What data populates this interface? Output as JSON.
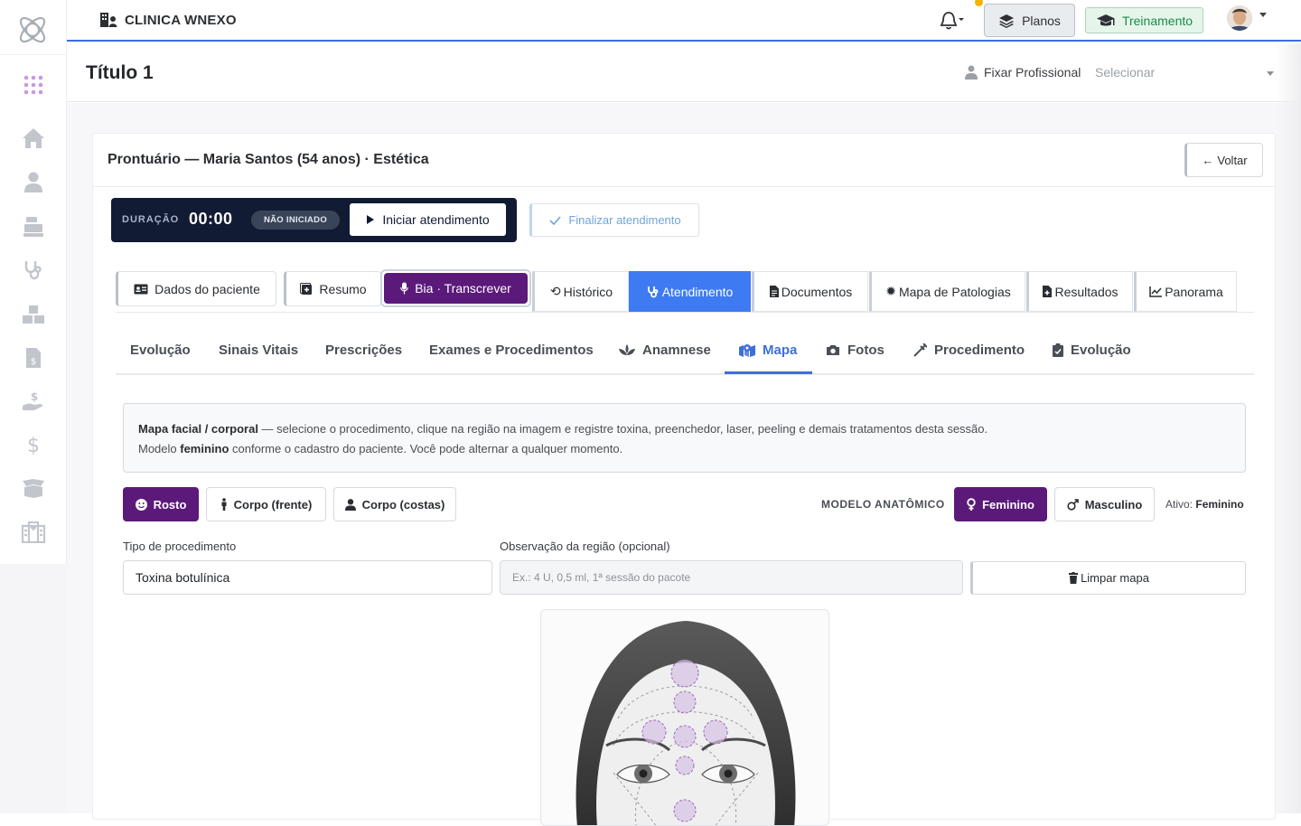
{
  "brand": {
    "name": "CLINICA WNEXO"
  },
  "topbar": {
    "planos": "Planos",
    "treinamento": "Treinamento"
  },
  "page": {
    "title": "Título 1",
    "fixar_label": "Fixar Profissional",
    "select_placeholder": "Selecionar"
  },
  "record": {
    "title": "Prontuário — Maria Santos (54 anos) · Estética",
    "back": "Voltar"
  },
  "timer": {
    "label": "DURAÇÃO",
    "value": "00:00",
    "status": "NÃO INICIADO",
    "start": "Iniciar atendimento",
    "finish": "Finalizar atendimento"
  },
  "tabs": {
    "dados": "Dados do paciente",
    "resumo": "Resumo",
    "bia": "Bia · Transcrever",
    "historico": "Histórico",
    "atendimento": "Atendimento",
    "documentos": "Documentos",
    "mapa_patologias": "Mapa de Patologias",
    "resultados": "Resultados",
    "panorama": "Panorama"
  },
  "subtabs": [
    "Evolução",
    "Sinais Vitais",
    "Prescrições",
    "Exames e Procedimentos",
    "Anamnese",
    "Mapa",
    "Fotos",
    "Procedimento",
    "Evolução"
  ],
  "info": {
    "strong1": "Mapa facial / corporal",
    "text1": " — selecione o procedimento, clique na região na imagem e registre toxina, preenchedor, laser, peeling e demais tratamentos desta sessão.",
    "text2a": "Modelo ",
    "strong2": "feminino",
    "text2b": " conforme o cadastro do paciente. Você pode alternar a qualquer momento."
  },
  "regions": {
    "rosto": "Rosto",
    "frente": "Corpo (frente)",
    "costas": "Corpo (costas)"
  },
  "modelo": {
    "label": "MODELO ANATÔMICO",
    "feminino": "Feminino",
    "masculino": "Masculino",
    "ativo_label": "Ativo:",
    "ativo_value": "Feminino"
  },
  "form": {
    "tipo_label": "Tipo de procedimento",
    "tipo_value": "Toxina botulínica",
    "obs_label": "Observação da região (opcional)",
    "obs_placeholder": "Ex.: 4 U, 0,5 ml, 1ª sessão do pacote",
    "limpar": "Limpar mapa"
  },
  "colors": {
    "primary_purple": "#5b1a7a",
    "accent_blue": "#3e7bf2",
    "timer_bg": "#111b33"
  }
}
